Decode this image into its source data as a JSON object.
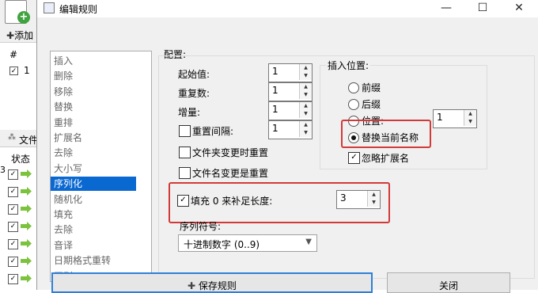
{
  "background_window": {
    "add_label": "添加",
    "list_header": "#",
    "list_row_number": "1",
    "files_label": "文件",
    "status_header": "状态",
    "row_marker": "3"
  },
  "dialog": {
    "title": "编辑规则",
    "window_buttons": {
      "minimize": "—",
      "maximize": "☐",
      "close": "✕"
    }
  },
  "rules_list": {
    "items": [
      "插入",
      "删除",
      "移除",
      "替换",
      "重排",
      "扩展名",
      "去除",
      "大小写",
      "序列化",
      "随机化",
      "填充",
      "去除",
      "音译",
      "日期格式重转",
      "正则"
    ],
    "selected_index": 8
  },
  "config": {
    "label": "配置:",
    "start_label": "起始值:",
    "start_value": "1",
    "repeat_label": "重复数:",
    "repeat_value": "1",
    "step_label": "增量:",
    "step_value": "1",
    "reset_every_label": "重置间隔:",
    "reset_every_value": "1",
    "reset_folder_label": "文件夹变更时重置",
    "reset_name_label": "文件名变更是重置",
    "pad_label": "填充 0 来补足长度:",
    "pad_value": "3",
    "seq_label": "序列符号:",
    "seq_value": "十进制数字 (0..9)"
  },
  "insert_position": {
    "label": "插入位置:",
    "prefix": "前缀",
    "suffix": "后缀",
    "position": "位置:",
    "position_value": "1",
    "replace_name": "替换当前名称",
    "ignore_ext": "忽略扩展名"
  },
  "buttons": {
    "save": "保存规则",
    "close": "关闭"
  }
}
